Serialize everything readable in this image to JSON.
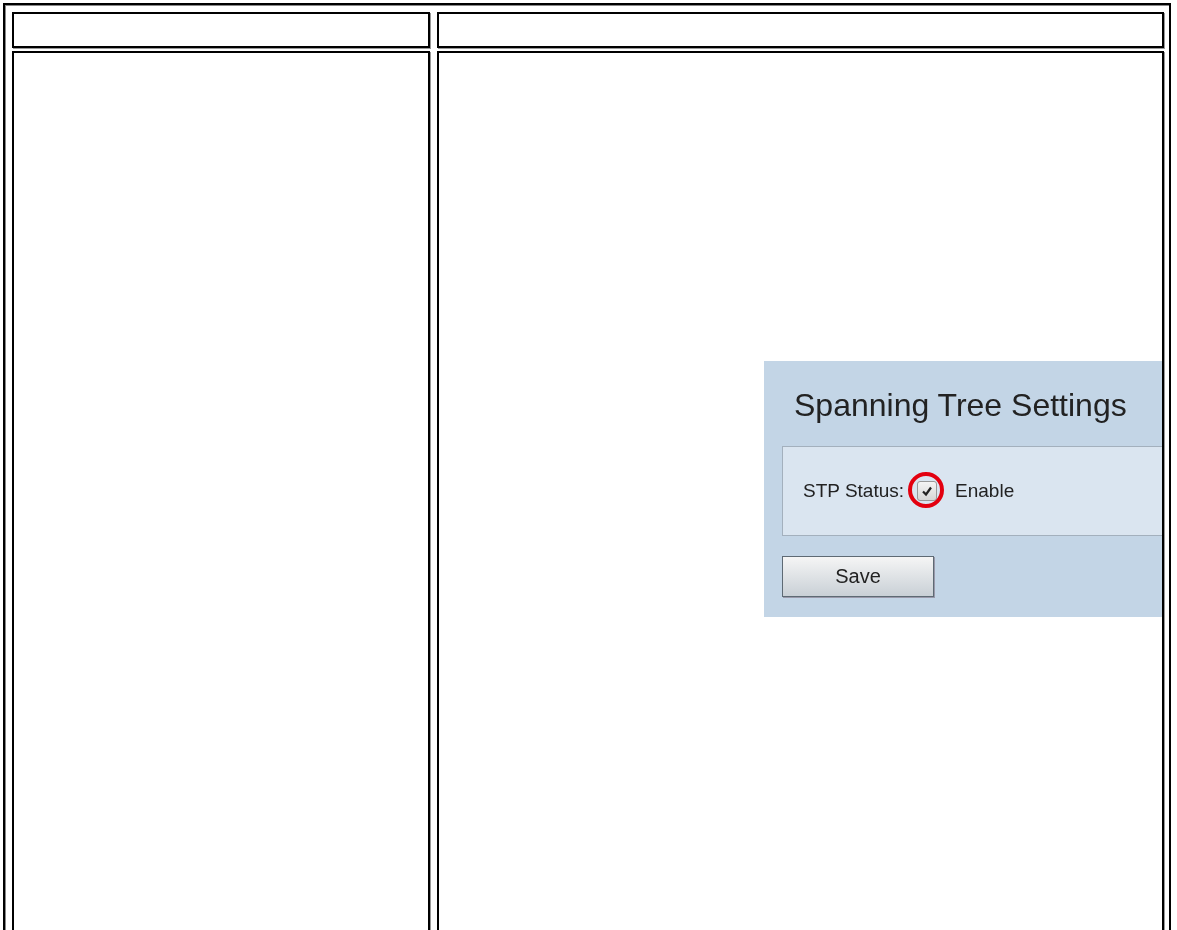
{
  "screenshot": {
    "title": "Spanning Tree Settings",
    "stp_status": {
      "label": "STP Status:",
      "checked": true,
      "highlighted": true,
      "option": "Enable"
    },
    "save_button": "Save"
  }
}
